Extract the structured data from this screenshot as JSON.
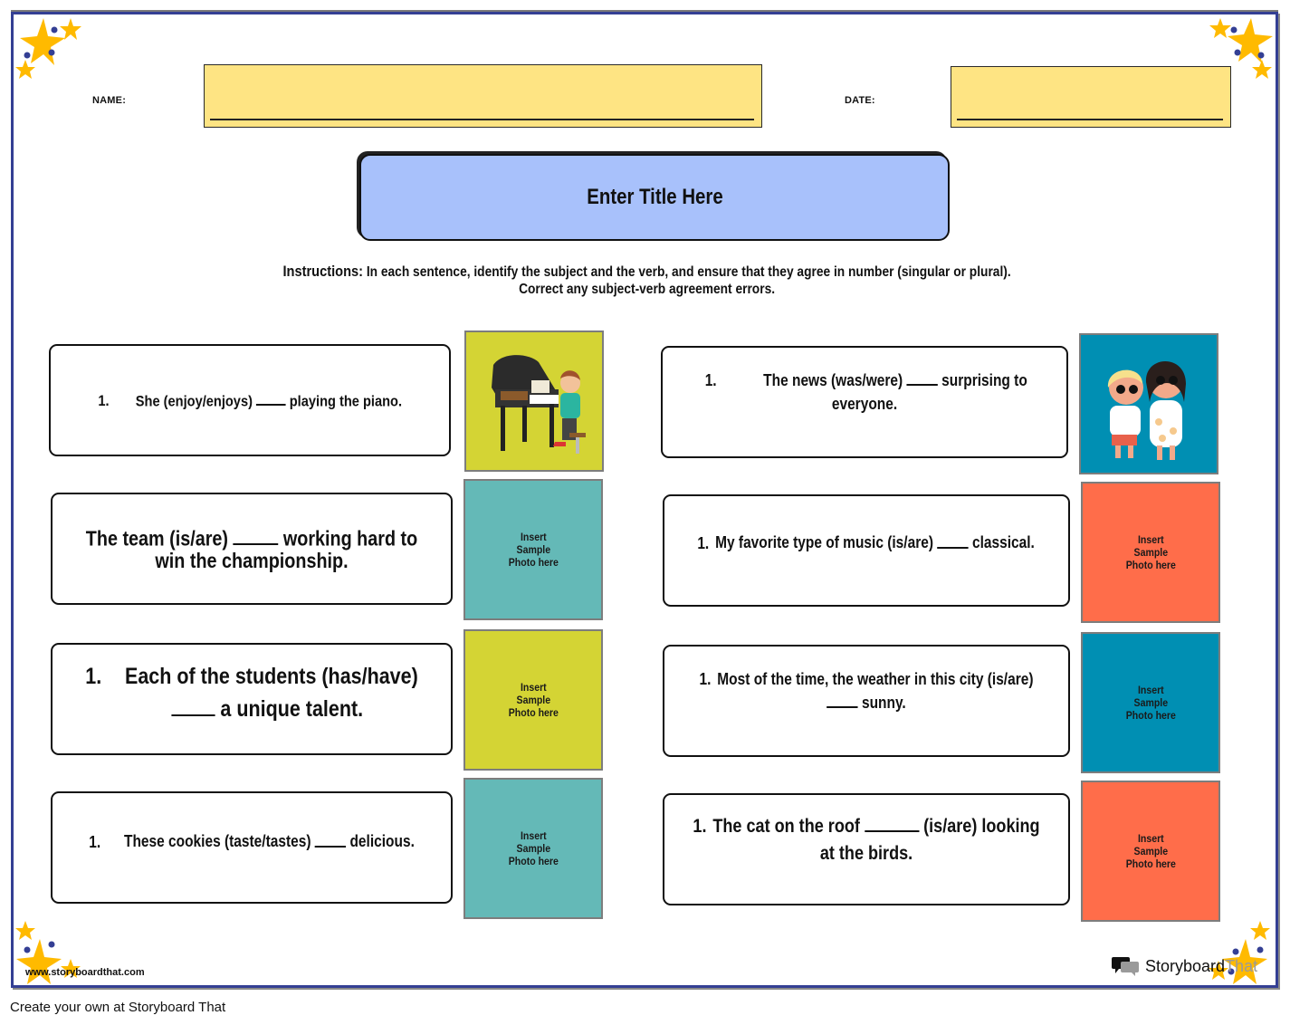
{
  "header": {
    "name_label": "NAME:",
    "date_label": "DATE:",
    "name_value": "",
    "date_value": ""
  },
  "title": "Enter Title Here",
  "instructions": {
    "prefix": "Instructions:",
    "line1": " In each sentence, identify the subject and the verb, and ensure that they agree in number (singular or plural).",
    "line2": "Correct any subject-verb agreement errors."
  },
  "colors": {
    "border": "#343f94",
    "field": "#fee483",
    "title_box": "#a8c1fb",
    "yellow_green": "#d4d434",
    "teal": "#64b9b7",
    "orange": "#ff6d4a",
    "blue": "#008fb3",
    "star": "#ffba00"
  },
  "left_items": [
    {
      "number": "1.",
      "before": "She (enjoy/enjoys) ",
      "after": " playing the piano.",
      "photo": "piano-boy-illustration",
      "photo_text": ""
    },
    {
      "number": "",
      "before": "The team (is/are) ",
      "after": " working hard to win the championship.",
      "photo": "placeholder",
      "photo_text": "Insert Sample Photo here"
    },
    {
      "number": "1.",
      "before": "Each of the students (has/have) ",
      "after": " a unique talent.",
      "photo": "placeholder",
      "photo_text": "Insert Sample Photo here"
    },
    {
      "number": "1.",
      "before": "These cookies (taste/tastes) ",
      "after": " delicious.",
      "photo": "placeholder",
      "photo_text": "Insert Sample Photo here"
    }
  ],
  "right_items": [
    {
      "number": "1.",
      "before": "The news (was/were) ",
      "after": " surprising to everyone.",
      "photo": "surprised-kids-illustration",
      "photo_text": ""
    },
    {
      "number": "1.",
      "before": "My favorite type of music (is/are) ",
      "after": " classical.",
      "photo": "placeholder",
      "photo_text": "Insert Sample Photo here"
    },
    {
      "number": "1.",
      "before": "Most of the time, the weather in this city (is/are) ",
      "after": " sunny.",
      "photo": "placeholder",
      "photo_text": "Insert Sample Photo here"
    },
    {
      "number": "1.",
      "before": "The cat on the roof ",
      "after": " (is/are) looking at the birds.",
      "photo": "placeholder",
      "photo_text": "Insert Sample Photo here"
    }
  ],
  "photo_placeholder": {
    "line1": "Insert",
    "line2": "Sample",
    "line3": "Photo here"
  },
  "footer": {
    "site": "www.storyboardthat.com",
    "brand_main": "Storyboard",
    "brand_that": "That",
    "create_note": "Create your own at Storyboard That"
  }
}
